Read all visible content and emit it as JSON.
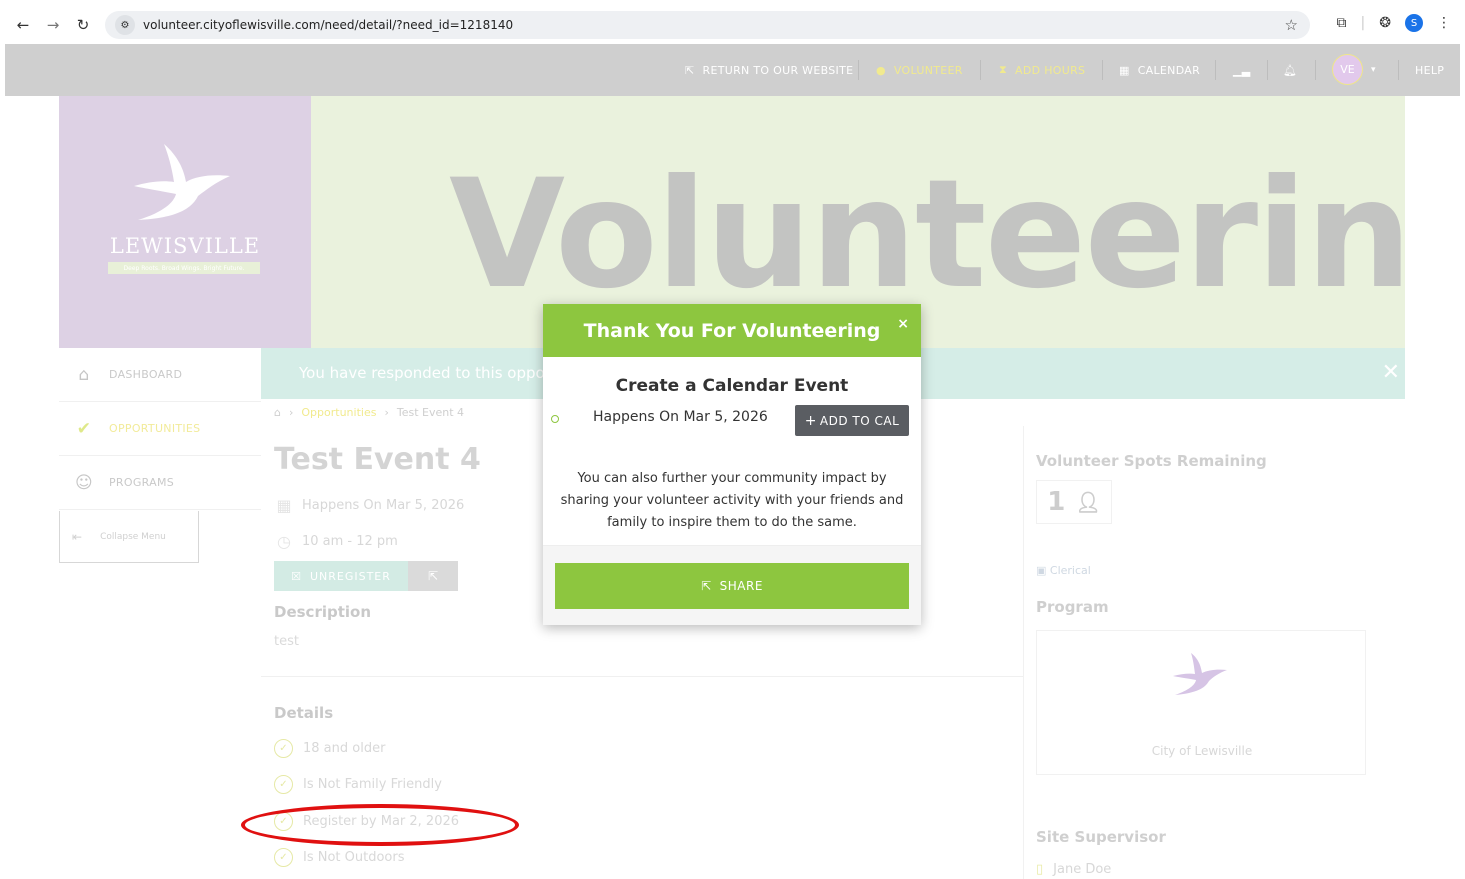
{
  "browser": {
    "url": "volunteer.cityoflewisville.com/need/detail/?need_id=1218140",
    "profile_initial": "S"
  },
  "site_nav": {
    "return_label": "RETURN TO OUR WEBSITE",
    "volunteer_label": "VOLUNTEER",
    "add_hours_label": "ADD HOURS",
    "calendar_label": "CALENDAR",
    "avatar_initials": "VE",
    "help_label": "HELP"
  },
  "banner": {
    "logo_text": "LEWISVILLE",
    "logo_tagline": "Deep Roots. Broad Wings. Bright Future.",
    "title": "Volunteering"
  },
  "alert": {
    "text": "You have responded to this oppor"
  },
  "sidebar": {
    "items": [
      {
        "label": "DASHBOARD",
        "icon": "home-icon"
      },
      {
        "label": "OPPORTUNITIES",
        "icon": "check-circle-icon"
      },
      {
        "label": "PROGRAMS",
        "icon": "programs-icon"
      }
    ],
    "collapse_label": "Collapse Menu"
  },
  "breadcrumb": {
    "link": "Opportunities",
    "current": "Test Event 4"
  },
  "event": {
    "title": "Test Event 4",
    "date": "Happens On Mar 5, 2026",
    "time": "10 am - 12 pm",
    "unregister_label": "UNREGISTER",
    "description_heading": "Description",
    "description": "test",
    "details_heading": "Details",
    "details": [
      "18 and older",
      "Is Not Family Friendly",
      "Register by Mar 2, 2026",
      "Is Not Outdoors"
    ]
  },
  "right_col": {
    "spots_heading": "Volunteer Spots Remaining",
    "spots_count": "1",
    "category": "Clerical",
    "program_heading": "Program",
    "program_name": "City of Lewisville",
    "supervisor_heading": "Site Supervisor",
    "supervisor_name": "Jane Doe"
  },
  "modal": {
    "title": "Thank You For Volunteering",
    "close_glyph": "×",
    "subtitle": "Create a Calendar Event",
    "event_date": "Happens On Mar 5, 2026",
    "add_to_cal_label": "ADD TO CAL",
    "body": "You can also further your community impact by sharing your volunteer activity with your friends and family to inspire them to do the same.",
    "share_label": "SHARE"
  },
  "colors": {
    "accent_green": "#8dc63f",
    "button_gray": "#5a5d62",
    "annotation_red": "#e01010"
  }
}
